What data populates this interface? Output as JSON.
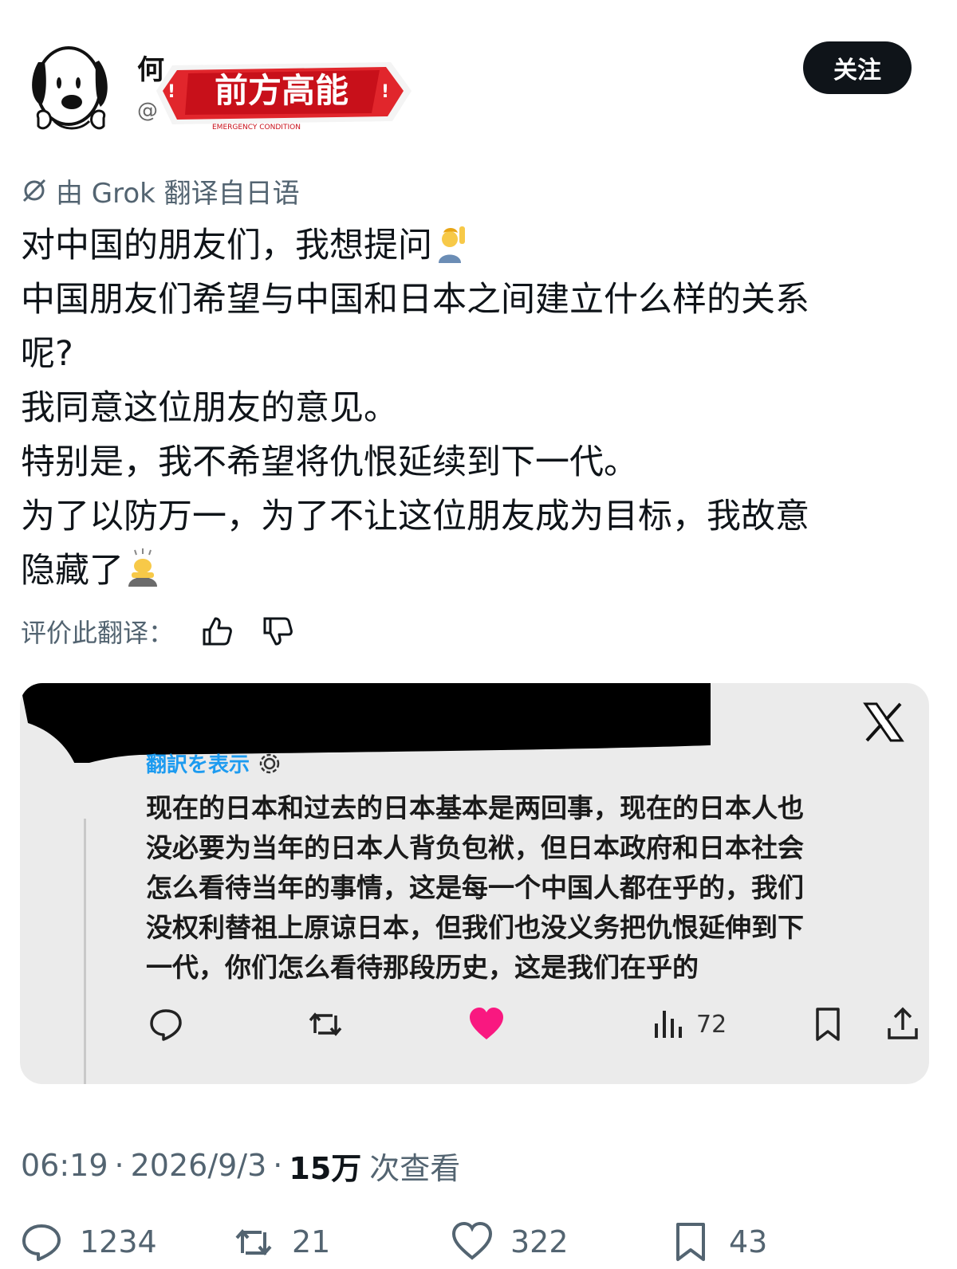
{
  "header": {
    "name_visible": "何",
    "handle_visible": "@",
    "sticker_text": "前方高能",
    "sticker_subtext": "EMERGENCY CONDITION",
    "follow_label": "关注"
  },
  "translation": {
    "translated_by": "由 Grok 翻译自日语",
    "rate_label": "评价此翻译："
  },
  "tweet": {
    "lines": [
      "对中国的朋友们，我想提问",
      "中国朋友们希望与中国和日本之间建立什么样的关系",
      "呢?",
      "我同意这位朋友的意见。",
      "特别是，我不希望将仇恨延续到下一代。",
      "为了以防万一，为了不让这位朋友成为目标，我故意",
      "隐藏了"
    ],
    "emoji_1": "person-raising-hand",
    "emoji_2": "person-bowing"
  },
  "quote": {
    "show_translation": "翻訳を表示",
    "lines": [
      "现在的日本和过去的日本基本是两回事，现在的日本人也",
      "没必要为当年的日本人背负包袱，但日本政府和日本社会",
      "怎么看待当年的事情，这是每一个中国人都在乎的，我们",
      "没权利替祖上原谅日本，但我们也没义务把仇恨延伸到下",
      "一代，你们怎么看待那段历史，这是我们在乎的"
    ],
    "views": "72",
    "like_color": "#f91880"
  },
  "meta": {
    "time": "06:19",
    "date": "2026/9/3",
    "views_count": "15万",
    "views_label": "次查看",
    "separator": "·"
  },
  "actions": {
    "replies": "1234",
    "reposts": "21",
    "likes": "322",
    "bookmarks": "43"
  }
}
